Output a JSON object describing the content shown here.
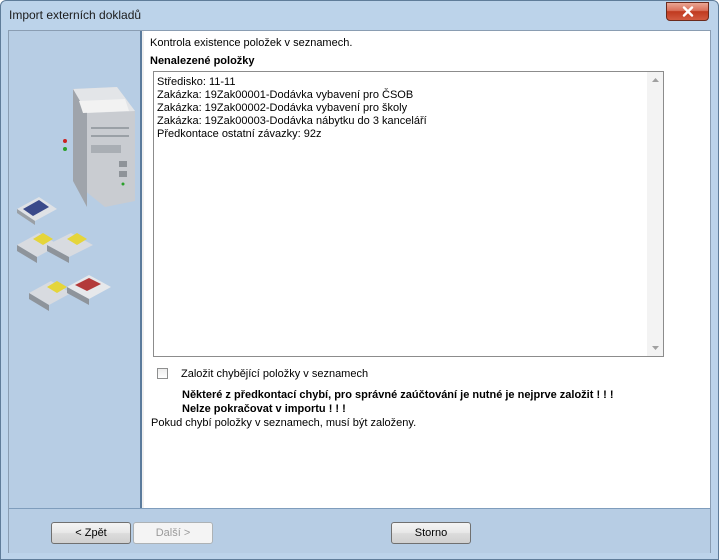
{
  "window": {
    "title": "Import externích dokladů"
  },
  "content": {
    "hint": "Kontrola existence položek v seznamech.",
    "section_title": "Nenalezené položky",
    "missing_items": [
      "Středisko: 11-11",
      "Zakázka: 19Zak00001-Dodávka vybavení pro ČSOB",
      "Zakázka: 19Zak00002-Dodávka vybavení pro školy",
      "Zakázka: 19Zak00003-Dodávka nábytku do 3 kanceláří",
      "Předkontace ostatní závazky: 92z"
    ],
    "checkbox_label": "Založit chybějící položky v seznamech",
    "checkbox_checked": false,
    "warning_line1": "Některé z předkontací chybí, pro správné zaúčtování je nutné je nejprve založit ! ! !",
    "warning_line2": "Nelze pokračovat v importu ! ! !",
    "note": "Pokud chybí položky v seznamech, musí být založeny."
  },
  "buttons": {
    "back": "< Zpět",
    "next": "Další >",
    "cancel": "Storno"
  },
  "colors": {
    "sidebar": "#b7cde4",
    "footer": "#b7cde4",
    "close_button": "#c0391f"
  },
  "icons": {
    "close": "close-icon",
    "sidebar_art": "computer-and-floppy-disks-illustration"
  }
}
